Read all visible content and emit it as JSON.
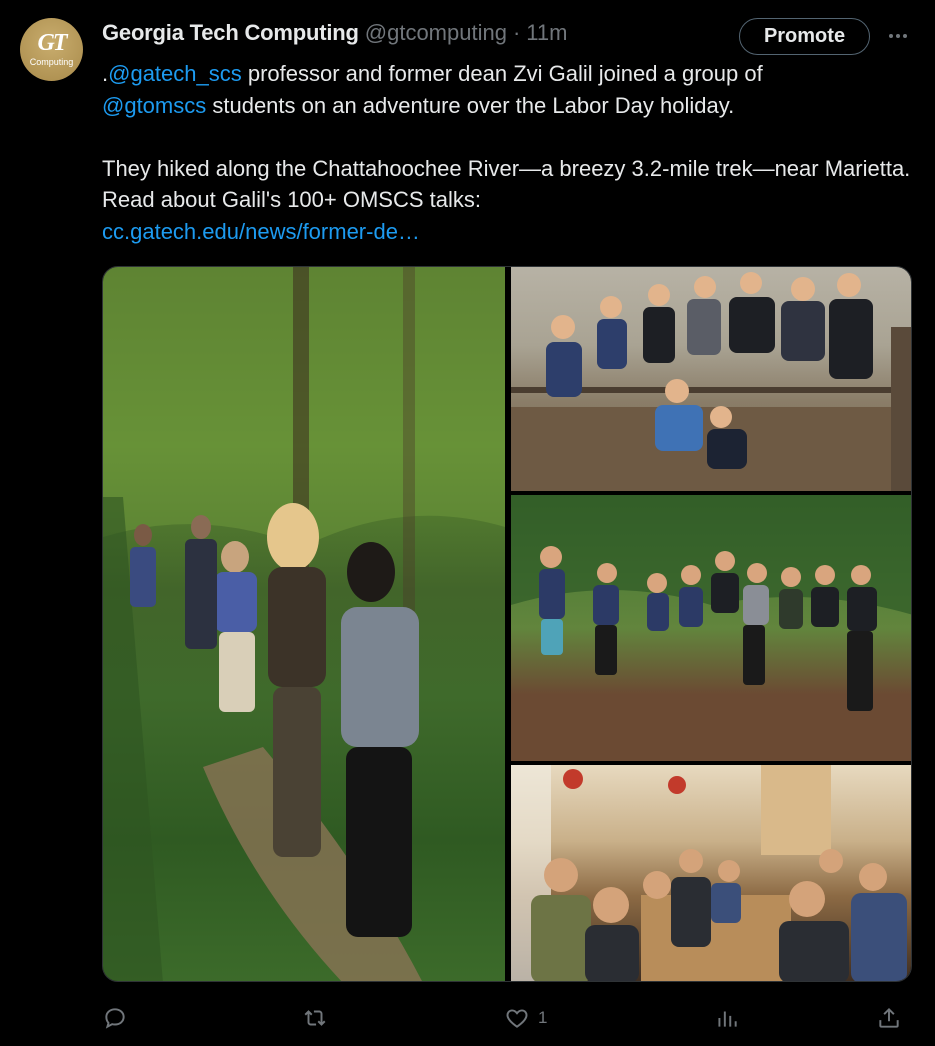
{
  "account": {
    "logo_text": "GT",
    "logo_subtext": "Computing",
    "name": "Georgia Tech Computing",
    "handle": "@gtcomputing",
    "separator": "·",
    "time": "11m"
  },
  "promote_label": "Promote",
  "more_icon": "more-dots-icon",
  "tweet": {
    "line1_prefix": ".",
    "mention1": "@gatech_scs",
    "line1_rest": " professor and former dean Zvi Galil joined a group of",
    "mention2": "@gtomscs",
    "line2_rest": " students on an adventure over the Labor Day holiday.",
    "para2": "They hiked along the Chattahoochee River—a breezy 3.2-mile trek—near Marietta. Read about Galil's 100+ OMSCS talks:",
    "url": "cc.gatech.edu/news/former-de…"
  },
  "actions": {
    "reply_icon": "reply-icon",
    "retweet_icon": "retweet-icon",
    "like_icon": "heart-icon",
    "like_count": "1",
    "views_icon": "analytics-icon",
    "share_icon": "share-icon"
  },
  "colors": {
    "background": "#000000",
    "text": "#e7e9ea",
    "muted": "#71767b",
    "link": "#1d9bf0",
    "logo_gold": "#b3995d"
  }
}
